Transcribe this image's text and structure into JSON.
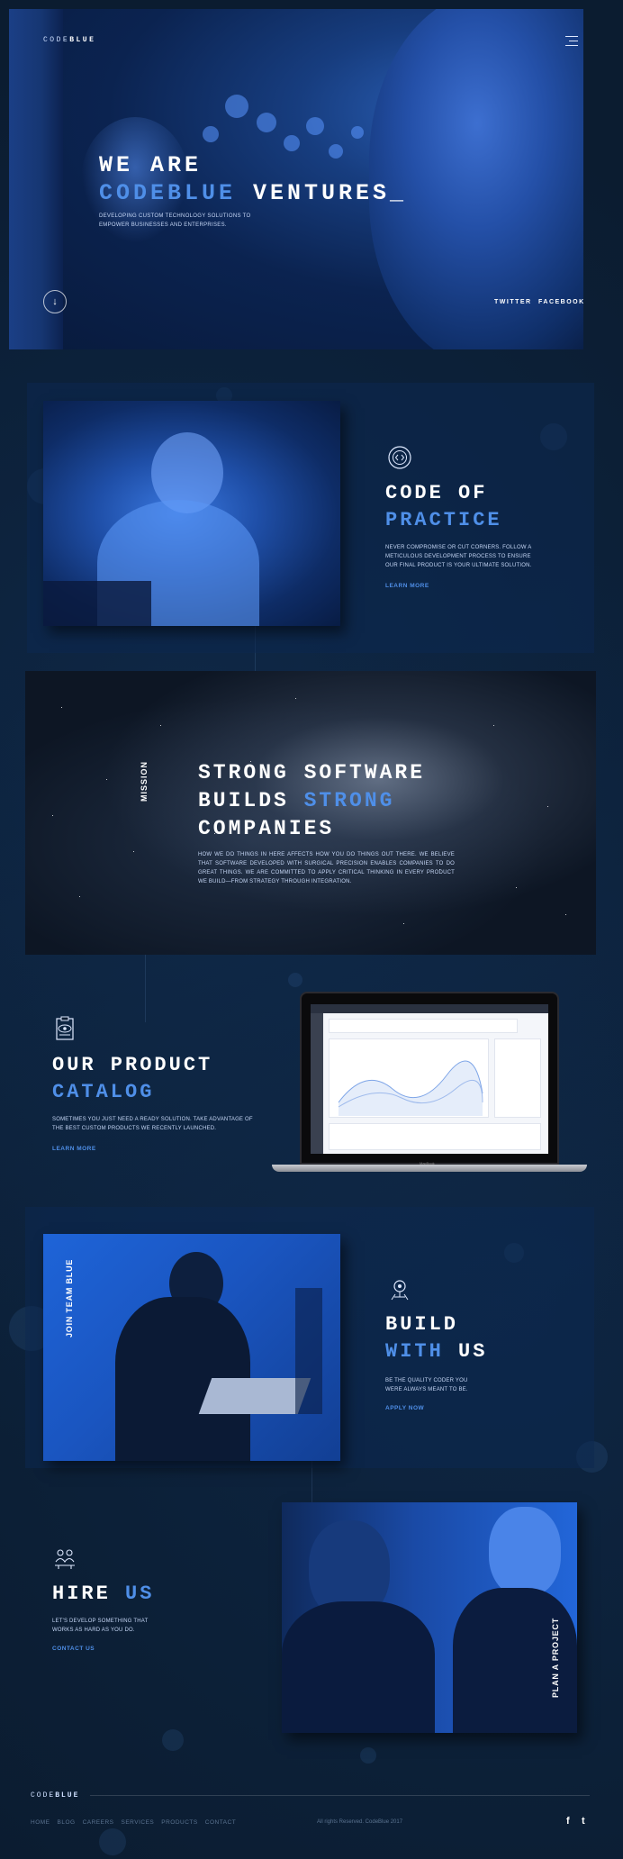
{
  "brand": {
    "logo_light": "CODE",
    "logo_bold": "BLUE"
  },
  "hero": {
    "title_line1": "WE ARE",
    "title_blue": "CODEBLUE",
    "title_rest": " VENTURES_",
    "subtitle": "DEVELOPING CUSTOM TECHNOLOGY SOLUTIONS TO EMPOWER BUSINESSES AND ENTERPRISES.",
    "scroll_icon": "↓",
    "social": [
      "TWITTER",
      "FACEBOOK"
    ]
  },
  "practice": {
    "title_line1": "CODE OF",
    "title_line2": "PRACTICE",
    "text": "NEVER COMPROMISE OR CUT CORNERS. FOLLOW A METICULOUS DEVELOPMENT PROCESS TO ENSURE OUR FINAL PRODUCT IS YOUR ULTIMATE SOLUTION.",
    "link": "LEARN MORE"
  },
  "mission": {
    "tag": "MISSION",
    "title_line1": "STRONG SOFTWARE",
    "title_line2_a": "BUILDS ",
    "title_line2_b": "STRONG",
    "title_line3": "COMPANIES",
    "text": "HOW WE DO THINGS IN HERE AFFECTS HOW YOU DO THINGS OUT THERE. WE BELIEVE THAT SOFTWARE DEVELOPED WITH SURGICAL PRECISION ENABLES COMPANIES TO DO GREAT THINGS. WE ARE COMMITTED TO APPLY CRITICAL THINKING IN EVERY PRODUCT WE BUILD—FROM STRATEGY THROUGH INTEGRATION."
  },
  "catalog": {
    "title_line1": "OUR PRODUCT",
    "title_line2": "CATALOG",
    "text": "SOMETIMES YOU JUST NEED A READY SOLUTION. TAKE ADVANTAGE OF THE BEST CUSTOM PRODUCTS WE RECENTLY LAUNCHED.",
    "link": "LEARN MORE",
    "laptop_label": "MacBook"
  },
  "build": {
    "tag": "JOIN TEAM BLUE",
    "title_line1": "BUILD",
    "title_line2_a": "WITH",
    "title_line2_b": " US",
    "text": "BE THE QUALITY CODER YOU WERE ALWAYS MEANT TO BE.",
    "link": "APPLY NOW"
  },
  "hire": {
    "title_a": "HIRE ",
    "title_b": "US",
    "text": "LET'S DEVELOP SOMETHING THAT WORKS AS HARD AS YOU DO.",
    "link": "CONTACT US",
    "tag": "PLAN A PROJECT"
  },
  "footer": {
    "logo_light": "CODE",
    "logo_bold": "BLUE",
    "nav": [
      "HOME",
      "BLOG",
      "CAREERS",
      "SERVICES",
      "PRODUCTS",
      "CONTACT"
    ],
    "copyright": "All rights Reserved. CodeBlue 2017",
    "social": [
      "f",
      "t"
    ]
  },
  "colors": {
    "accent": "#4f8fe8",
    "background": "#0b1c30"
  }
}
